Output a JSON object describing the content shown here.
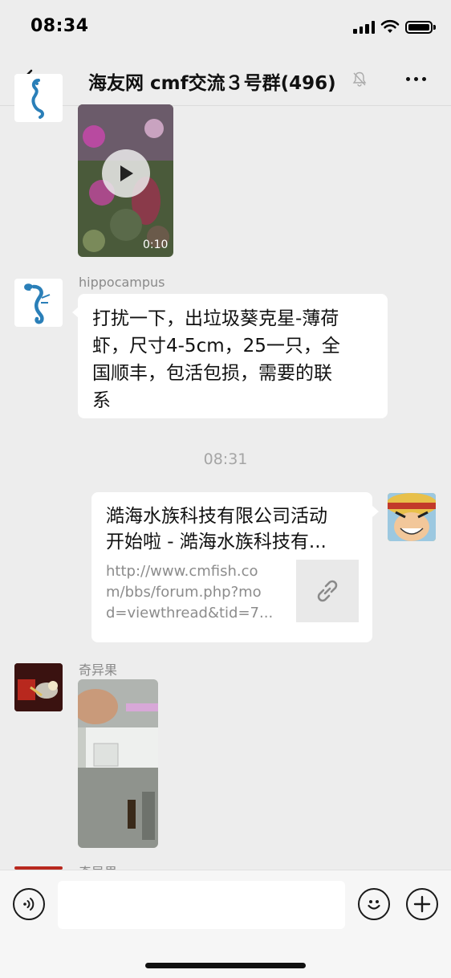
{
  "status_bar": {
    "time": "08:34"
  },
  "nav": {
    "title": "海友网 cmf交流３号群(496)"
  },
  "messages": {
    "video1": {
      "duration": "0:10"
    },
    "msg1": {
      "sender": "hippocampus",
      "lines": [
        "打扰一下，出垃圾葵克星-薄荷",
        "虾，尺寸4-5cm，25一只，全",
        "国顺丰，包活包损，需要的联",
        "系"
      ]
    },
    "divider_time": "08:31",
    "link": {
      "title_lines": [
        "澔海水族科技有限公司活动",
        "开始啦 - 澔海水族科技有..."
      ],
      "desc_lines": [
        "http://www.cmfish.co",
        "m/bbs/forum.php?mo",
        "d=viewthread&tid=7..."
      ]
    },
    "msg3": {
      "sender": "奇异果"
    },
    "msg4": {
      "sender": "奇异果"
    }
  },
  "input": {
    "placeholder": ""
  },
  "colors": {
    "background": "#ededed",
    "bubble": "#ffffff",
    "timestamp": "#a5a5a5"
  },
  "icons": {
    "back": "chevron-left-icon",
    "mute": "bell-off-icon",
    "more": "more-dots-icon",
    "voice": "voice-icon",
    "emoji": "emoji-icon",
    "plus": "plus-icon",
    "play": "play-icon",
    "link": "link-icon"
  }
}
